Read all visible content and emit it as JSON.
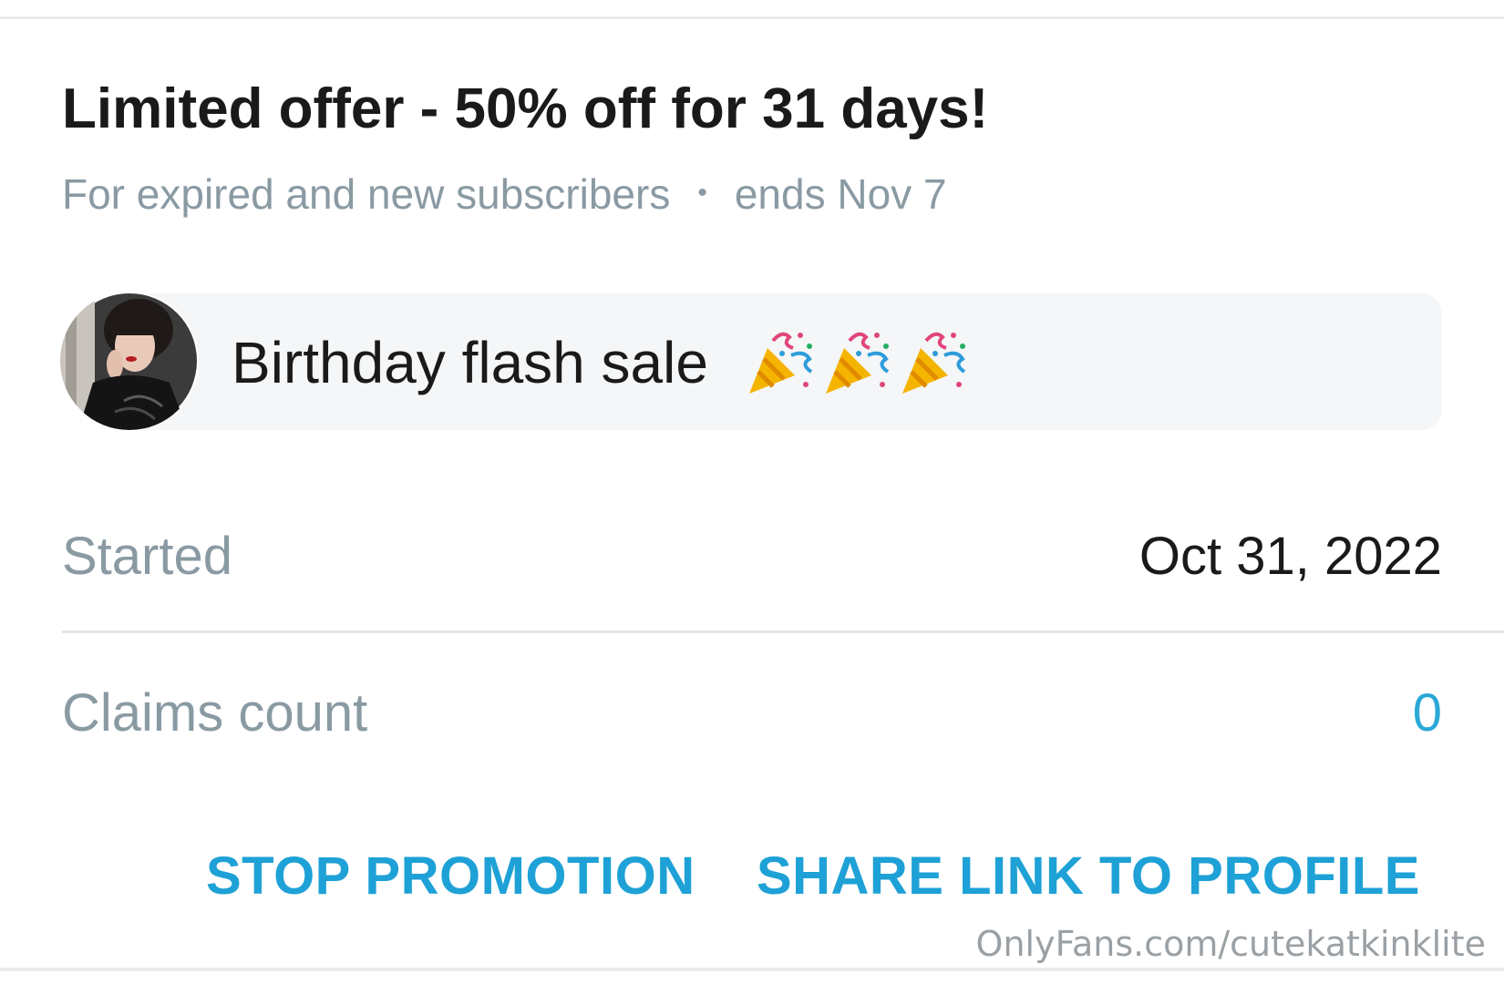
{
  "offer": {
    "title": "Limited offer - 50% off for 31 days!",
    "audience": "For expired and new subscribers",
    "separator": "•",
    "ends": "ends Nov 7"
  },
  "message": {
    "text": "Birthday flash sale",
    "emoji_icons": [
      "party-popper-icon",
      "party-popper-icon",
      "party-popper-icon"
    ]
  },
  "details": {
    "started_label": "Started",
    "started_value": "Oct 31, 2022",
    "claims_label": "Claims count",
    "claims_value": "0"
  },
  "actions": {
    "stop_label": "STOP PROMOTION",
    "share_label": "SHARE LINK TO PROFILE"
  },
  "watermark": "OnlyFans.com/cutekatkinklite",
  "colors": {
    "accent": "#1ea1d6",
    "muted_text": "#8a9aa3",
    "bubble_bg": "#f4f6f7"
  }
}
